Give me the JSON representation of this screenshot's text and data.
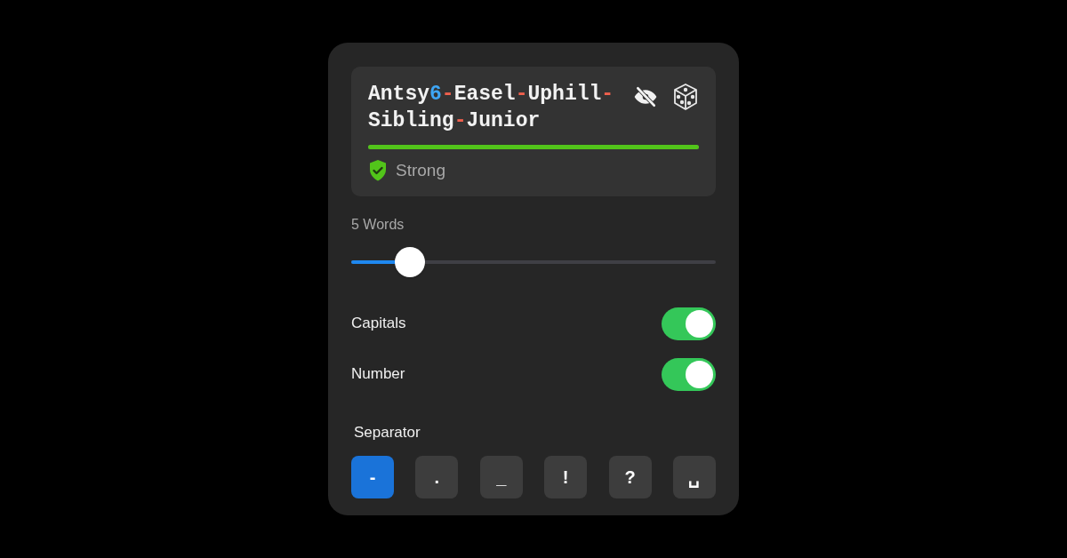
{
  "password": {
    "lines": [
      [
        {
          "text": "Antsy",
          "kind": "word"
        },
        {
          "text": "6",
          "kind": "digit"
        },
        {
          "text": "-",
          "kind": "separator"
        },
        {
          "text": "Easel",
          "kind": "word"
        },
        {
          "text": "-",
          "kind": "separator"
        },
        {
          "text": "Uphill",
          "kind": "word"
        },
        {
          "text": "-",
          "kind": "separator"
        }
      ],
      [
        {
          "text": "Sibling",
          "kind": "word"
        },
        {
          "text": "-",
          "kind": "separator"
        },
        {
          "text": "Junior",
          "kind": "word"
        }
      ]
    ],
    "strength": {
      "level": 1,
      "label": "Strong"
    }
  },
  "words": {
    "label": "5 Words",
    "level": 0.16
  },
  "toggles": [
    {
      "label": "Capitals",
      "on": true
    },
    {
      "label": "Number",
      "on": true
    }
  ],
  "separator": {
    "label": "Separator",
    "options": [
      {
        "symbol": "-",
        "selected": true
      },
      {
        "symbol": ".",
        "selected": false
      },
      {
        "symbol": "_",
        "selected": false
      },
      {
        "symbol": "!",
        "selected": false
      },
      {
        "symbol": "?",
        "selected": false
      },
      {
        "symbol": "␣",
        "selected": false
      }
    ]
  }
}
